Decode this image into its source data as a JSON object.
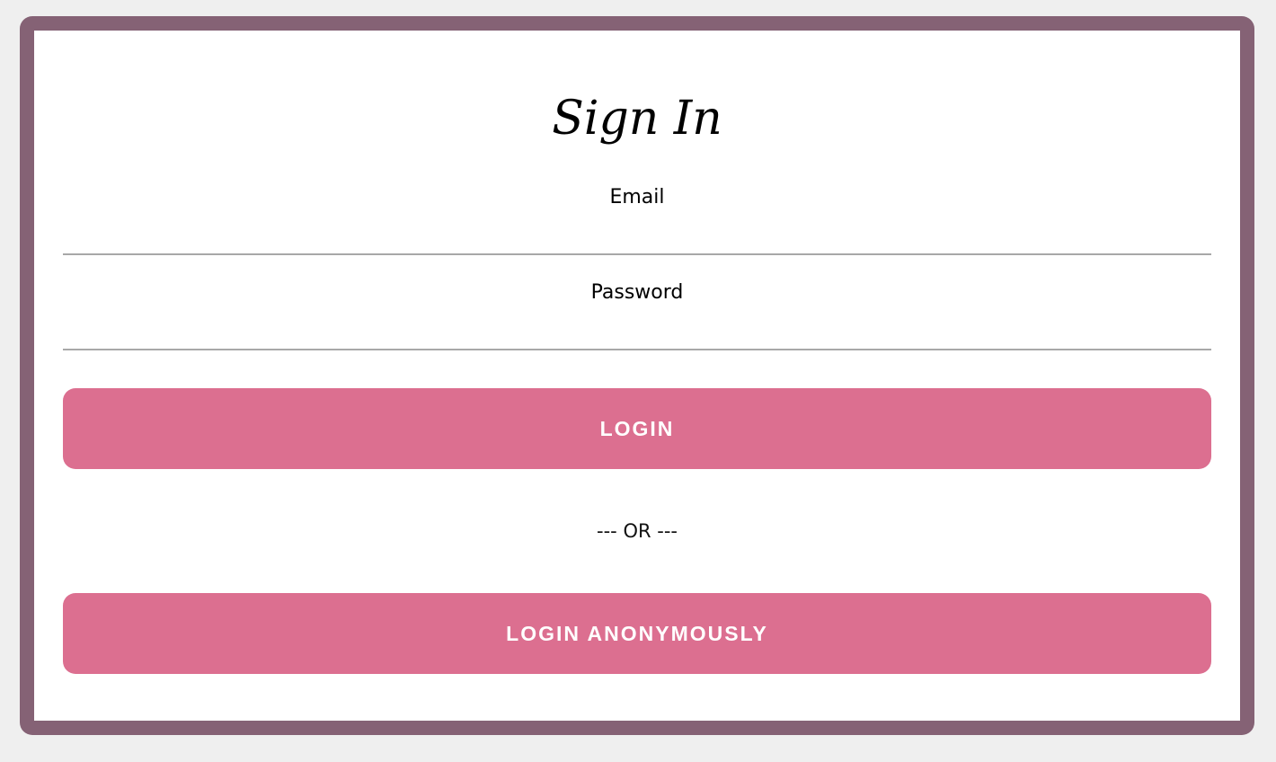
{
  "signin": {
    "title": "Sign In",
    "email": {
      "label": "Email",
      "value": ""
    },
    "password": {
      "label": "Password",
      "value": ""
    },
    "login_button": "LOGIN",
    "divider": "--- OR ---",
    "anonymous_button": "LOGIN ANONYMOUSLY"
  },
  "colors": {
    "frame": "#856275",
    "button": "#dc6f90",
    "background": "#efefef",
    "field_underline": "#a8a8a8"
  }
}
